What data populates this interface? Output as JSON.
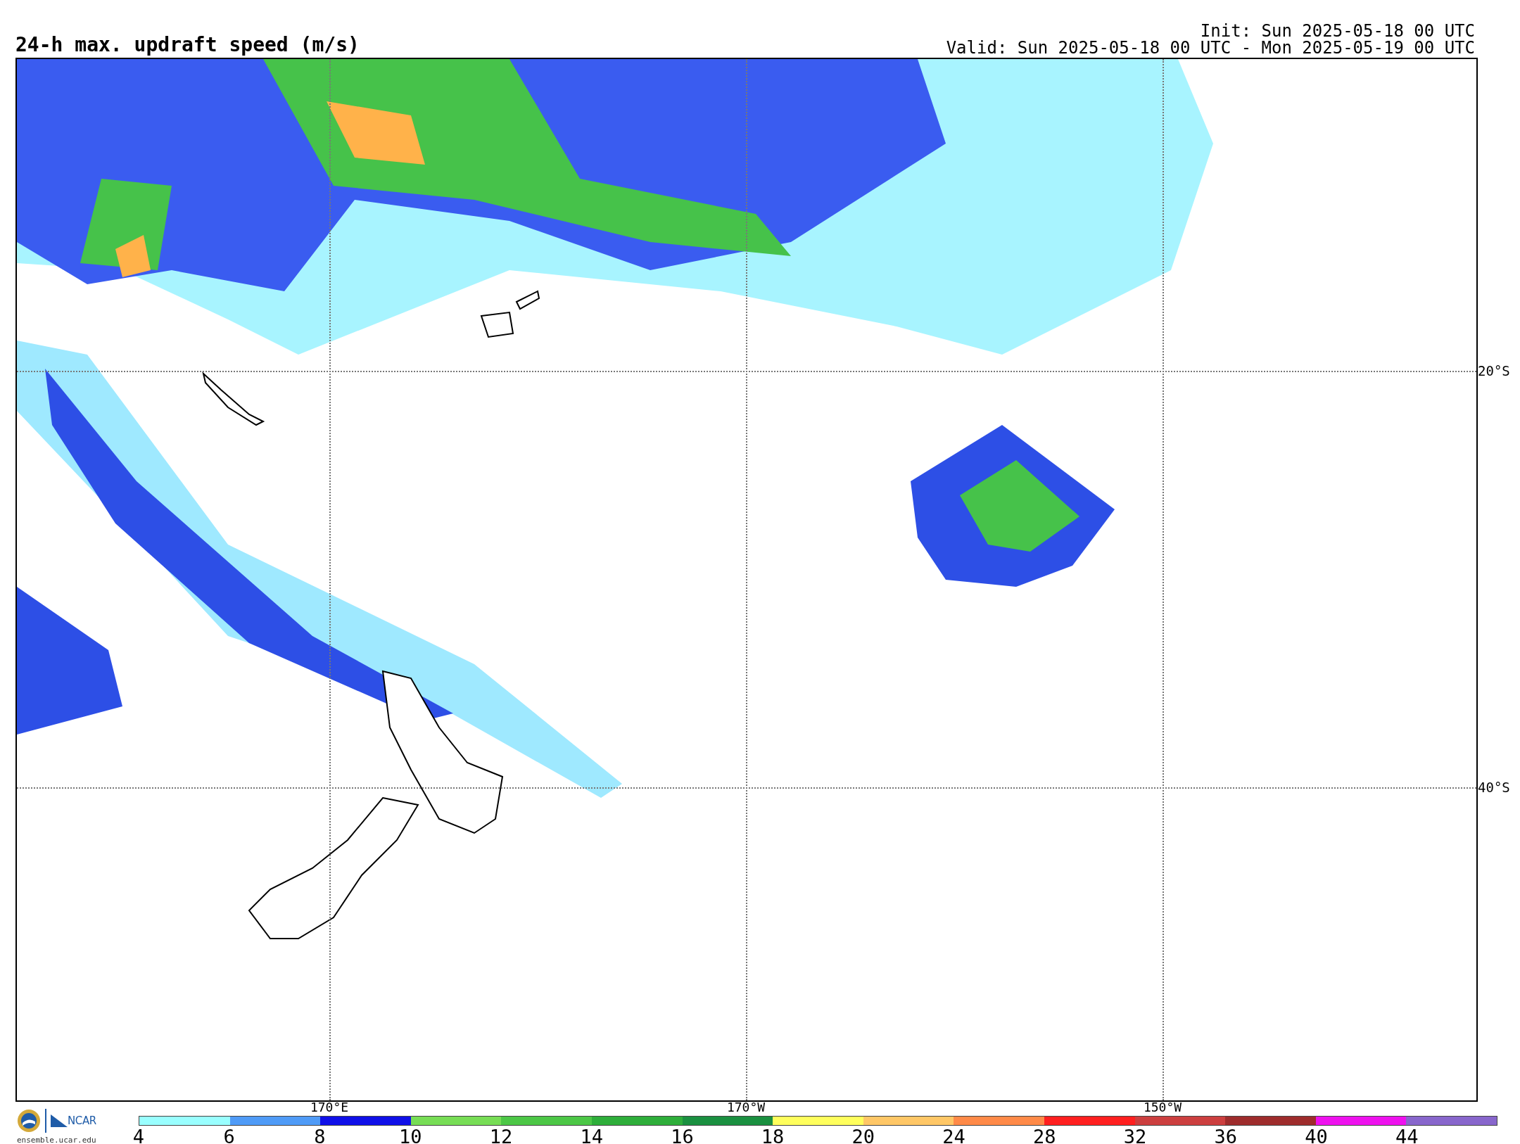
{
  "title": "24-h max. updraft speed (m/s)",
  "init": "Init: Sun 2025-05-18 00 UTC",
  "valid": "Valid: Sun 2025-05-18 00 UTC - Mon 2025-05-19 00 UTC",
  "map": {
    "meridians": [
      "170°E",
      "170°W",
      "150°W"
    ],
    "parallels": [
      "20°S",
      "40°S"
    ]
  },
  "logo": {
    "wordmark": "NCAR",
    "url": "ensemble.ucar.edu"
  },
  "colorbar": {
    "bins": [
      {
        "label": "4",
        "color": "#99ffff"
      },
      {
        "label": "6",
        "color": "#4f9bf7"
      },
      {
        "label": "8",
        "color": "#1010e8"
      },
      {
        "label": "10",
        "color": "#77dd55"
      },
      {
        "label": "12",
        "color": "#4cc746"
      },
      {
        "label": "14",
        "color": "#2eae3a"
      },
      {
        "label": "16",
        "color": "#1a9040"
      },
      {
        "label": "18",
        "color": "#ffff5c"
      },
      {
        "label": "20",
        "color": "#ffc766"
      },
      {
        "label": "24",
        "color": "#ff8a48"
      },
      {
        "label": "28",
        "color": "#ff1f1f"
      },
      {
        "label": "32",
        "color": "#cc3f3f"
      },
      {
        "label": "36",
        "color": "#9e2c2c"
      },
      {
        "label": "40",
        "color": "#ee11ee"
      },
      {
        "label": "44",
        "color": "#8866cc"
      }
    ]
  }
}
